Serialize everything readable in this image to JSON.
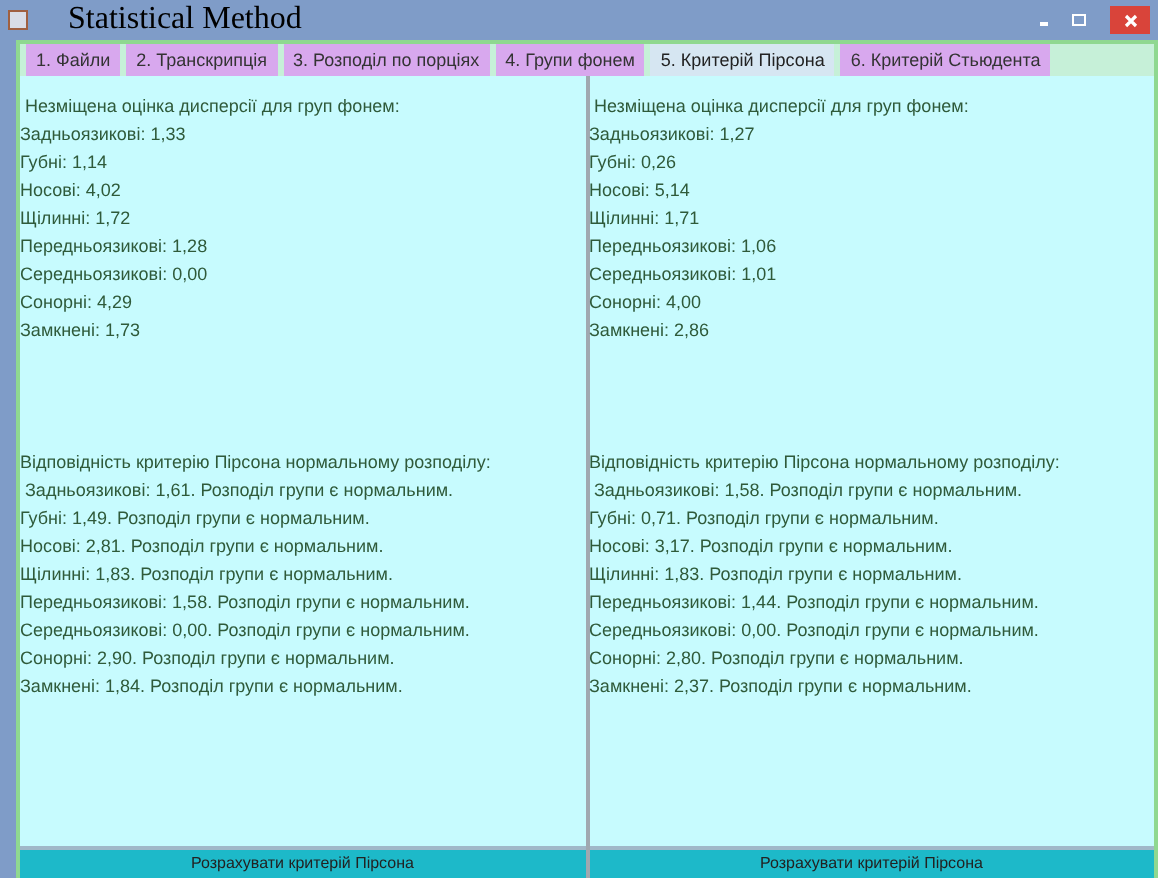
{
  "window": {
    "title": "Statistical Method"
  },
  "tabs": [
    {
      "label": "1. Файли",
      "selected": false
    },
    {
      "label": "2. Транскрипція",
      "selected": false
    },
    {
      "label": "3. Розподіл по порціях",
      "selected": false
    },
    {
      "label": "4. Групи фонем",
      "selected": false
    },
    {
      "label": "5. Критерій Пірсона",
      "selected": true
    },
    {
      "label": "6. Критерій Стьюдента",
      "selected": false
    }
  ],
  "panels": [
    {
      "variance_title": " Незміщена оцінка дисперсії для груп фонем:",
      "variance_lines": [
        "Задньоязикові: 1,33",
        "Губні: 1,14",
        "Носові: 4,02",
        "Щілинні: 1,72",
        "Передньоязикові: 1,28",
        "Середньоязикові: 0,00",
        "Сонорні: 4,29",
        "Замкнені: 1,73"
      ],
      "criterion_title": "Відповідність критерію Пірсона нормальному розподілу:",
      "criterion_lines": [
        " Задньоязикові: 1,61. Розподіл групи є нормальним.",
        "Губні: 1,49. Розподіл групи є нормальним.",
        "Носові: 2,81. Розподіл групи є нормальним.",
        "Щілинні: 1,83. Розподіл групи є нормальним.",
        "Передньоязикові: 1,58. Розподіл групи є нормальним.",
        "Середньоязикові: 0,00. Розподіл групи є нормальним.",
        "Сонорні: 2,90. Розподіл групи є нормальним.",
        "Замкнені: 1,84. Розподіл групи є нормальним."
      ],
      "button": "Розрахувати критерій Пірсона"
    },
    {
      "variance_title": " Незміщена оцінка дисперсії для груп фонем:",
      "variance_lines": [
        "Задньоязикові: 1,27",
        "Губні: 0,26",
        "Носові: 5,14",
        "Щілинні: 1,71",
        "Передньоязикові: 1,06",
        "Середньоязикові: 1,01",
        "Сонорні: 4,00",
        "Замкнені: 2,86"
      ],
      "criterion_title": "Відповідність критерію Пірсона нормальному розподілу:",
      "criterion_lines": [
        " Задньоязикові: 1,58. Розподіл групи є нормальним.",
        "Губні: 0,71. Розподіл групи є нормальним.",
        "Носові: 3,17. Розподіл групи є нормальним.",
        "Щілинні: 1,83. Розподіл групи є нормальним.",
        "Передньоязикові: 1,44. Розподіл групи є нормальним.",
        "Середньоязикові: 0,00. Розподіл групи є нормальним.",
        "Сонорні: 2,80. Розподіл групи є нормальним.",
        "Замкнені: 2,37. Розподіл групи є нормальним."
      ],
      "button": "Розрахувати критерій Пірсона"
    }
  ]
}
